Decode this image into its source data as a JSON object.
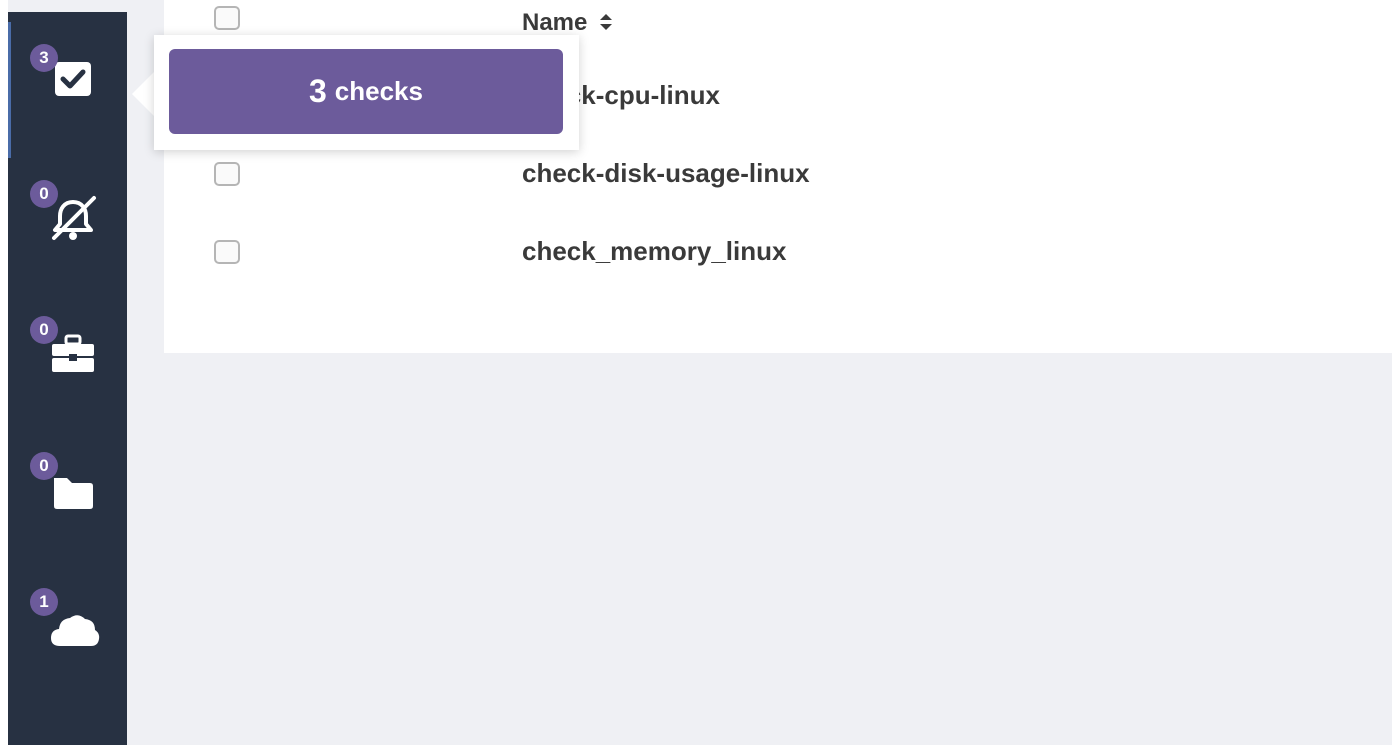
{
  "sidebar": {
    "items": [
      {
        "id": "checks",
        "icon": "checkbox-icon",
        "badge": "3"
      },
      {
        "id": "silenced",
        "icon": "bell-slash-icon",
        "badge": "0"
      },
      {
        "id": "jobs",
        "icon": "briefcase-icon",
        "badge": "0"
      },
      {
        "id": "folders",
        "icon": "folder-icon",
        "badge": "0"
      },
      {
        "id": "clouds",
        "icon": "cloud-icon",
        "badge": "1"
      }
    ]
  },
  "table": {
    "header": {
      "name_label": "Name",
      "sort_icon": "sort-icon"
    },
    "rows": [
      {
        "name": "check-cpu-linux"
      },
      {
        "name": "check-disk-usage-linux"
      },
      {
        "name": "check_memory_linux"
      }
    ]
  },
  "tooltip": {
    "count": "3",
    "label": "checks"
  },
  "colors": {
    "sidebar_bg": "#273142",
    "accent": "#6c5b9b",
    "page_bg": "#eff0f4",
    "panel_bg": "#ffffff",
    "text": "#3a3a3a"
  }
}
